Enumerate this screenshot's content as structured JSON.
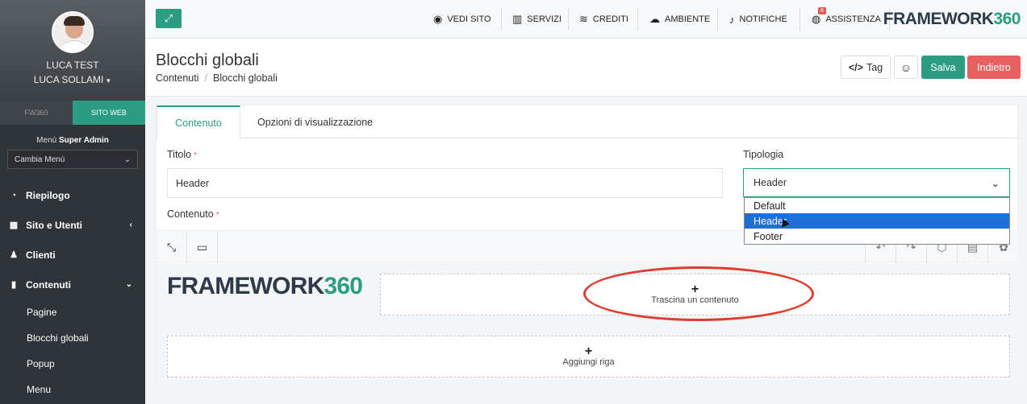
{
  "sidebar": {
    "user_line1": "LUCA TEST",
    "user_line2": "LUCA SOLLAMI",
    "switch_tabs": [
      "FW360",
      "SITO WEB"
    ],
    "menu_prefix": "Menù",
    "menu_role": "Super Admin",
    "menu_select": "Cambia Menù",
    "items": [
      {
        "label": "Riepilogo",
        "icon": "dashboard-icon"
      },
      {
        "label": "Sito e Utenti",
        "icon": "sitemap-icon"
      },
      {
        "label": "Clienti",
        "icon": "user-icon"
      },
      {
        "label": "Contenuti",
        "icon": "file-icon"
      }
    ],
    "sub_items": [
      "Pagine",
      "Blocchi globali",
      "Popup",
      "Menu"
    ]
  },
  "topbar": {
    "items": [
      {
        "label": "VEDI SITO",
        "icon": "eye-icon"
      },
      {
        "label": "SERVIZI",
        "icon": "building-icon"
      },
      {
        "label": "CREDITI",
        "icon": "coins-icon"
      },
      {
        "label": "AMBIENTE",
        "icon": "cloud-icon"
      },
      {
        "label": "NOTIFICHE",
        "icon": "bell-icon"
      },
      {
        "label": "ASSISTENZA",
        "icon": "globe-icon"
      }
    ],
    "assist_badge": "8",
    "brand_text": "FRAMEWORK",
    "brand_num": "360"
  },
  "header": {
    "title": "Blocchi globali",
    "breadcrumb": [
      "Contenuti",
      "Blocchi globali"
    ],
    "tag_label": "Tag",
    "save_label": "Salva",
    "back_label": "Indietro"
  },
  "tabs": [
    "Contenuto",
    "Opzioni di visualizzazione"
  ],
  "form": {
    "titolo_label": "Titolo",
    "titolo_value": "Header",
    "tipologia_label": "Tipologia",
    "tipologia_value": "Header",
    "tipologia_options": [
      "Default",
      "Header",
      "Footer"
    ],
    "contenuto_label": "Contenuto",
    "required_mark": "*"
  },
  "editor": {
    "logo_text": "FRAMEWORK",
    "logo_num": "360",
    "drop_label": "Trascina un contenuto",
    "add_row_label": "Aggiungi riga",
    "plus": "+"
  },
  "colors": {
    "accent": "#2a9d82",
    "danger": "#e66060",
    "sidebar": "#2f3438",
    "highlight": "#1e6fd6",
    "annotation": "#e03c2f"
  }
}
